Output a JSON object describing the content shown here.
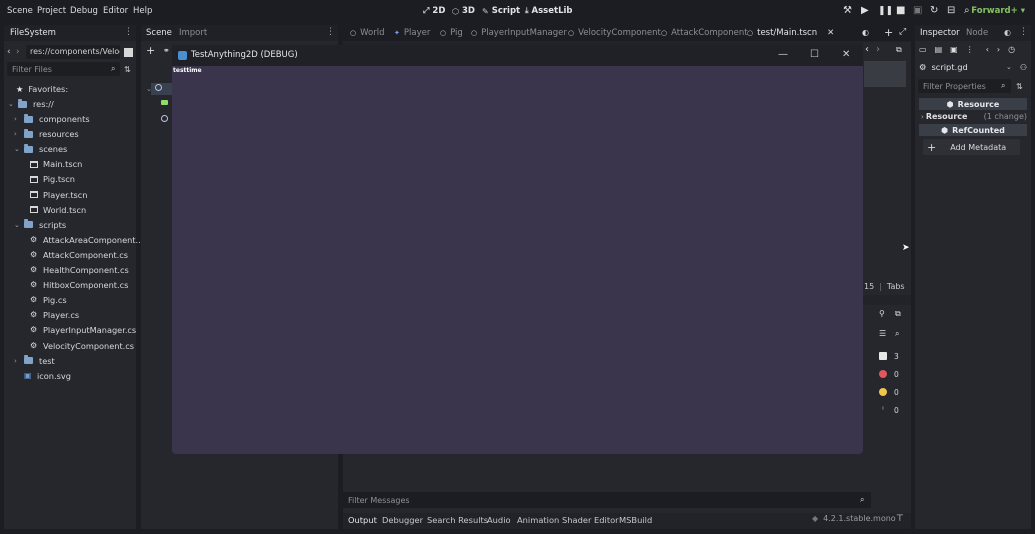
{
  "menu": [
    "Scene",
    "Project",
    "Debug",
    "Editor",
    "Help"
  ],
  "workspaces": [
    {
      "label": "2D",
      "icon": "2d-icon"
    },
    {
      "label": "3D",
      "icon": "3d-icon"
    },
    {
      "label": "Script",
      "icon": "script-icon"
    },
    {
      "label": "AssetLib",
      "icon": "assetlib-icon"
    }
  ],
  "renderer": "Forward+",
  "filesystem": {
    "tab": "FileSystem",
    "path": "res://components/Veloc",
    "filter_placeholder": "Filter Files",
    "favorites": "Favorites:",
    "root": "res://",
    "items": [
      {
        "label": "components",
        "type": "folder",
        "level": 1,
        "arrow": "›"
      },
      {
        "label": "resources",
        "type": "folder",
        "level": 1,
        "arrow": "›"
      },
      {
        "label": "scenes",
        "type": "folder",
        "level": 1,
        "arrow": "⌄"
      },
      {
        "label": "Main.tscn",
        "type": "scene",
        "level": 2,
        "arrow": ""
      },
      {
        "label": "Pig.tscn",
        "type": "scene",
        "level": 2,
        "arrow": ""
      },
      {
        "label": "Player.tscn",
        "type": "scene",
        "level": 2,
        "arrow": ""
      },
      {
        "label": "World.tscn",
        "type": "scene",
        "level": 2,
        "arrow": ""
      },
      {
        "label": "scripts",
        "type": "folder",
        "level": 1,
        "arrow": "⌄"
      },
      {
        "label": "AttackAreaComponent...",
        "type": "script",
        "level": 2,
        "arrow": ""
      },
      {
        "label": "AttackComponent.cs",
        "type": "script",
        "level": 2,
        "arrow": ""
      },
      {
        "label": "HealthComponent.cs",
        "type": "script",
        "level": 2,
        "arrow": ""
      },
      {
        "label": "HitboxComponent.cs",
        "type": "script",
        "level": 2,
        "arrow": ""
      },
      {
        "label": "Pig.cs",
        "type": "script",
        "level": 2,
        "arrow": ""
      },
      {
        "label": "Player.cs",
        "type": "script",
        "level": 2,
        "arrow": ""
      },
      {
        "label": "PlayerInputManager.cs",
        "type": "script",
        "level": 2,
        "arrow": ""
      },
      {
        "label": "VelocityComponent.cs",
        "type": "script",
        "level": 2,
        "arrow": ""
      },
      {
        "label": "test",
        "type": "folder",
        "level": 1,
        "arrow": "›"
      },
      {
        "label": "icon.svg",
        "type": "image",
        "level": 1,
        "arrow": ""
      }
    ]
  },
  "scene_panel": {
    "tabs": [
      "Scene",
      "Import"
    ]
  },
  "editor_tabs": [
    "World",
    "Player",
    "Pig",
    "PlayerInputManager",
    "VelocityComponent",
    "AttackComponent",
    "test/Main.tscn"
  ],
  "game_window": {
    "title": "TestAnything2D (DEBUG)",
    "debug_text": "testtime",
    "bg_color": "#3a354d"
  },
  "script_status": {
    "line": "15",
    "indent": "Tabs"
  },
  "output": {
    "filter_placeholder": "Filter Messages",
    "counters": [
      {
        "value": "3",
        "kind": "log"
      },
      {
        "value": "0",
        "kind": "error"
      },
      {
        "value": "0",
        "kind": "warning"
      },
      {
        "value": "0",
        "kind": "info"
      }
    ]
  },
  "bottom_tabs": [
    "Output",
    "Debugger",
    "Search Results",
    "Audio",
    "Animation",
    "Shader Editor",
    "MSBuild"
  ],
  "version": "4.2.1.stable.mono",
  "inspector": {
    "tabs": [
      "Inspector",
      "Node"
    ],
    "resource_name": "script.gd",
    "filter_placeholder": "Filter Properties",
    "section_resource": "Resource",
    "resource_row": "Resource",
    "resource_changes": "(1 change)",
    "section_refcounted": "RefCounted",
    "add_metadata": "Add Metadata"
  }
}
